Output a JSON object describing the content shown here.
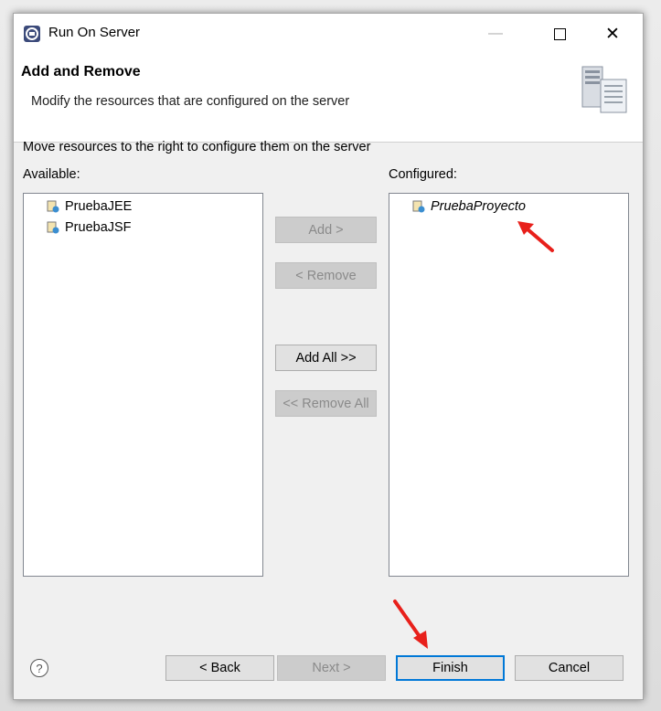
{
  "window": {
    "title": "Run On Server",
    "minimize_glyph": "—",
    "close_glyph": "✕"
  },
  "header": {
    "title": "Add and Remove",
    "description": "Modify the resources that are configured on the server"
  },
  "body": {
    "instruction": "Move resources to the right to configure them on the server",
    "available_label": "Available:",
    "configured_label": "Configured:",
    "available_items": [
      "PruebaJEE",
      "PruebaJSF"
    ],
    "configured_items": [
      "PruebaProyecto"
    ]
  },
  "transfer_buttons": {
    "add": "Add >",
    "remove": "< Remove",
    "add_all": "Add All >>",
    "remove_all": "<< Remove All"
  },
  "footer": {
    "help": "?",
    "back": "< Back",
    "next": "Next >",
    "finish": "Finish",
    "cancel": "Cancel"
  },
  "colors": {
    "annotation_arrow": "#e8201b",
    "default_button_border": "#0078d7"
  },
  "icons": {
    "app": "eclipse-server-icon",
    "project": "web-project-icon",
    "wizard_banner": "server-banner-icon"
  }
}
